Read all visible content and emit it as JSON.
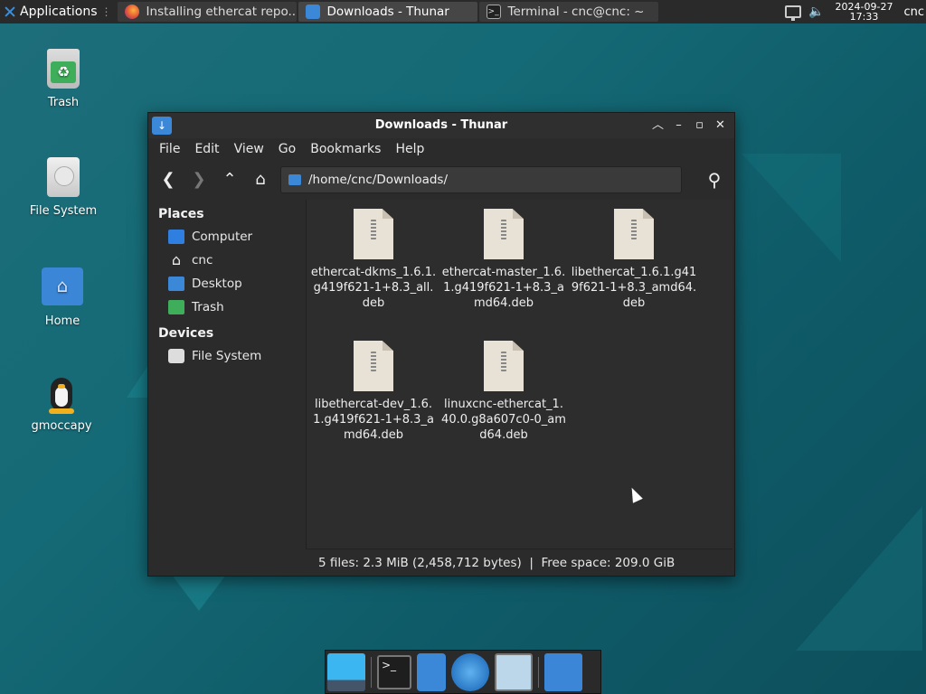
{
  "panel": {
    "applications_label": "Applications",
    "tasks": [
      {
        "label": "Installing ethercat repo...",
        "icon": "firefox-icon"
      },
      {
        "label": "Downloads - Thunar",
        "icon": "folder-download-icon"
      },
      {
        "label": "Terminal - cnc@cnc: ~",
        "icon": "terminal-icon"
      }
    ],
    "clock_date": "2024-09-27",
    "clock_time": "17:33",
    "user": "cnc"
  },
  "desktop": {
    "icons": [
      {
        "label": "Trash",
        "icon": "trash-icon"
      },
      {
        "label": "File System",
        "icon": "drive-icon"
      },
      {
        "label": "Home",
        "icon": "home-folder-icon"
      },
      {
        "label": "gmoccapy",
        "icon": "tux-penguin-icon"
      }
    ]
  },
  "window": {
    "title": "Downloads - Thunar",
    "menu": [
      "File",
      "Edit",
      "View",
      "Go",
      "Bookmarks",
      "Help"
    ],
    "location": "/home/cnc/Downloads/",
    "sidebar": {
      "places_heading": "Places",
      "places": [
        "Computer",
        "cnc",
        "Desktop",
        "Trash"
      ],
      "devices_heading": "Devices",
      "devices": [
        "File System"
      ]
    },
    "files": [
      "ethercat-dkms_1.6.1.g419f621-1+8.3_all.deb",
      "ethercat-master_1.6.1.g419f621-1+8.3_amd64.deb",
      "libethercat_1.6.1.g419f621-1+8.3_amd64.deb",
      "libethercat-dev_1.6.1.g419f621-1+8.3_amd64.deb",
      "linuxcnc-ethercat_1.40.0.g8a607c0-0_amd64.deb"
    ],
    "status": "5 files: 2.3 MiB (2,458,712 bytes)  |  Free space: 209.0 GiB"
  },
  "colors": {
    "accent": "#3c88d8",
    "window_bg": "#2b2b2b",
    "desktop_bg": "#146a76"
  }
}
